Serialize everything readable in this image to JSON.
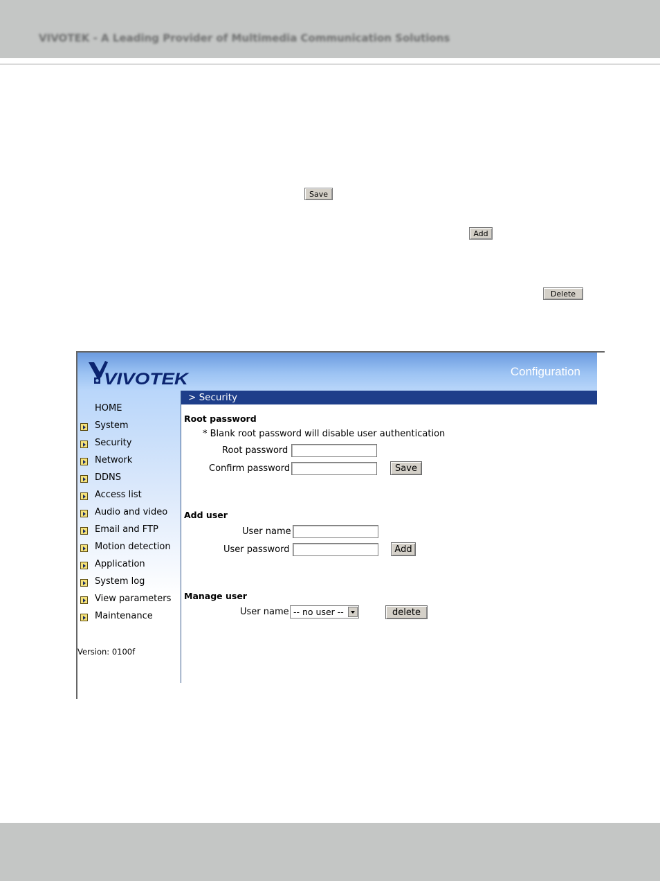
{
  "page_header": "VIVOTEK - A Leading Provider of Multimedia Communication Solutions",
  "doc_buttons": {
    "save": "Save",
    "add": "Add",
    "delete": "Delete"
  },
  "screenshot": {
    "brand": "VIVOTEK",
    "config_title": "Configuration",
    "sidebar": {
      "items": [
        {
          "label": "HOME"
        },
        {
          "label": "System"
        },
        {
          "label": "Security"
        },
        {
          "label": "Network"
        },
        {
          "label": "DDNS"
        },
        {
          "label": "Access list"
        },
        {
          "label": "Audio and video"
        },
        {
          "label": "Email and FTP"
        },
        {
          "label": "Motion detection"
        },
        {
          "label": "Application"
        },
        {
          "label": "System log"
        },
        {
          "label": "View parameters"
        },
        {
          "label": "Maintenance"
        }
      ],
      "version": "Version: 0100f"
    },
    "section_title": "> Security",
    "root_password": {
      "heading": "Root password",
      "note": "* Blank root password will disable user authentication",
      "root_label": "Root password",
      "confirm_label": "Confirm password",
      "root_value": "",
      "confirm_value": "",
      "save_label": "Save"
    },
    "add_user": {
      "heading": "Add user",
      "name_label": "User name",
      "password_label": "User password",
      "name_value": "",
      "password_value": "",
      "add_label": "Add"
    },
    "manage_user": {
      "heading": "Manage user",
      "name_label": "User name",
      "selected": "-- no user --",
      "delete_label": "delete"
    }
  },
  "colors": {
    "band": "#c4c6c5",
    "section_bar": "#1e3e8a",
    "banner_top": "#6b9be0"
  }
}
